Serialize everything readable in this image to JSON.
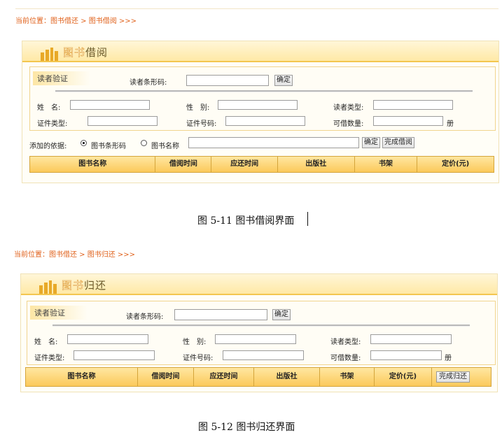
{
  "borrow": {
    "breadcrumb": "当前位置：图书借还 > 图书借阅 >>>",
    "title_ghost": "图书",
    "title": "借阅",
    "section_label": "读者验证",
    "barcode_label": "读者条形码:",
    "confirm_label": "确定",
    "name_label": "姓　名:",
    "gender_label": "性　别:",
    "reader_type_label": "读者类型:",
    "id_type_label": "证件类型:",
    "id_no_label": "证件号码:",
    "borrowable_label": "可借数量:",
    "unit": "册",
    "basis_label": "添加的依据:",
    "radio_barcode": "图书条形码",
    "radio_name": "图书名称",
    "selected_basis": "图书条形码",
    "confirm2_label": "确定",
    "finish_label": "完成借阅",
    "columns": [
      "图书名称",
      "借阅时间",
      "应还时间",
      "出版社",
      "书架",
      "定价(元)"
    ],
    "caption": "图 5-11  图书借阅界面"
  },
  "return": {
    "breadcrumb": "当前位置：图书借还 > 图书归还 >>>",
    "title_ghost": "图书",
    "title": "归还",
    "section_label": "读者验证",
    "barcode_label": "读者条形码:",
    "confirm_label": "确定",
    "name_label": "姓　名:",
    "gender_label": "性　别:",
    "reader_type_label": "读者类型:",
    "id_type_label": "证件类型:",
    "id_no_label": "证件号码:",
    "borrowable_label": "可借数量:",
    "unit": "册",
    "finish_label": "完成归还",
    "columns": [
      "图书名称",
      "借阅时间",
      "应还时间",
      "出版社",
      "书架",
      "定价(元)"
    ],
    "caption": "图 5-12  图书归还界面"
  },
  "colors": {
    "accent": "#e0621c",
    "header_gold": "#fbc95a",
    "border": "#d4a53b"
  }
}
